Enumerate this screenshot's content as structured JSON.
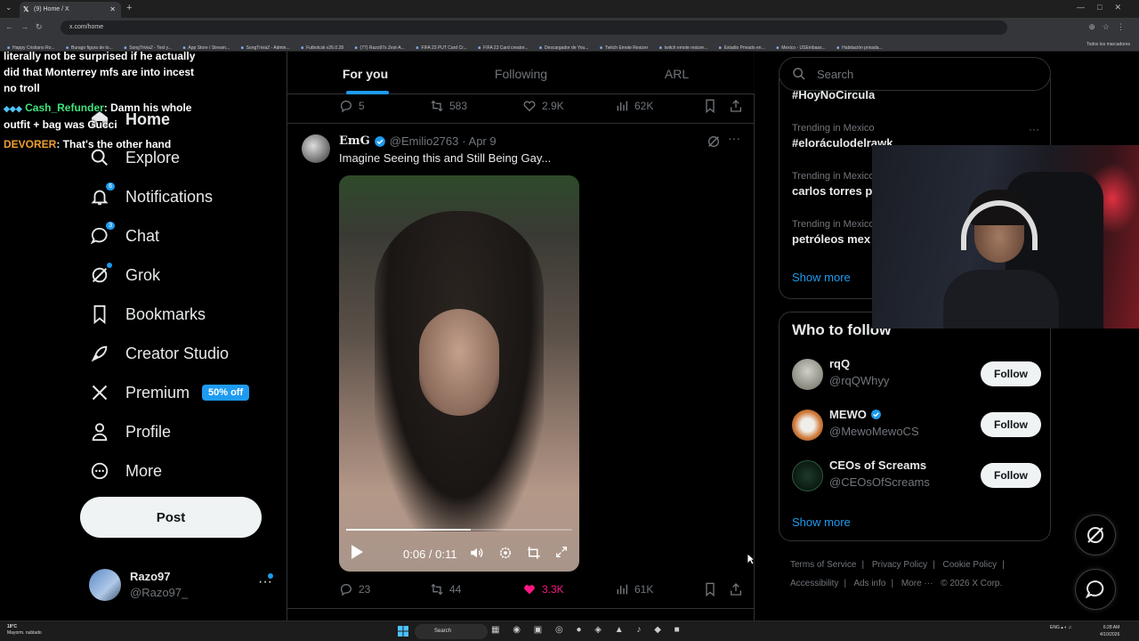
{
  "browser": {
    "tab_title": "(9) Home / X",
    "url": "x.com/home",
    "bookmarks": [
      "Happy Cristiano Ro...",
      "Burago figura de to...",
      "SongTrivia2 - Test y...",
      "App Store / Stream...",
      "SongTrivia2 - Admin...",
      "Futbolcsk v26.0.28",
      "(77) Razo97s Zest-A...",
      "FIFA 23 PUT Card Cr...",
      "FIFA 23 Card creator...",
      "Descargador de You...",
      "Twitch Emote Resizer",
      "twitch emote resizer...",
      "Estadio Privado en...",
      "Mexico - USEmbass...",
      "Habitación privada..."
    ],
    "all_bookmarks": "Todos los marcadores"
  },
  "chat": {
    "line1": "literally not be surprised if he actually did that Monterrey mfs are into incest no troll",
    "user2": "Cash_Refunder",
    "msg2": ": Damn his whole outfit + bag was Gucci",
    "user3": "DEVORER",
    "msg3": ": That's the other hand"
  },
  "nav": {
    "home": "Home",
    "explore": "Explore",
    "notifications": "Notifications",
    "notifications_badge": "6",
    "chat": "Chat",
    "chat_badge": "3",
    "grok": "Grok",
    "bookmarks": "Bookmarks",
    "creator_studio": "Creator Studio",
    "premium": "Premium",
    "premium_promo": "50% off",
    "profile": "Profile",
    "more": "More",
    "post": "Post",
    "account_name": "Razo97",
    "account_handle": "@Razo97_"
  },
  "feed": {
    "tabs": [
      "For you",
      "Following",
      "ARL"
    ],
    "prev_stats": {
      "replies": "5",
      "reposts": "583",
      "likes": "2.9K",
      "views": "62K"
    },
    "tweet": {
      "display_name": "EmG",
      "handle": "@Emilio2763",
      "date": "· Apr 9",
      "text": "Imagine Seeing this and Still Being Gay...",
      "video_time": "0:06 / 0:11",
      "video_progress": 0.55,
      "stats": {
        "replies": "23",
        "reposts": "44",
        "likes": "3.3K",
        "views": "61K"
      }
    }
  },
  "sidebar": {
    "search_placeholder": "Search",
    "trend0_name": "#HoyNoCircula",
    "trends": [
      {
        "context": "Trending in Mexico",
        "name": "#eloráculodelrawk"
      },
      {
        "context": "Trending in Mexico",
        "name": "carlos torres p"
      },
      {
        "context": "Trending in Mexico",
        "name": "petróleos mex"
      }
    ],
    "show_more": "Show more",
    "who_to_follow_title": "Who to follow",
    "follow": [
      {
        "name": "rqQ",
        "handle": "@rqQWhyy",
        "button": "Follow"
      },
      {
        "name": "MEWO",
        "handle": "@MewoMewoCS",
        "button": "Follow"
      },
      {
        "name": "CEOs of Screams",
        "handle": "@CEOsOfScreams",
        "button": "Follow"
      }
    ],
    "footer": [
      "Terms of Service",
      "Privacy Policy",
      "Cookie Policy",
      "Accessibility",
      "Ads info",
      "More ···",
      "© 2026 X Corp."
    ]
  },
  "taskbar": {
    "temp": "18°C",
    "weather": "Mayorm. nublado",
    "search": "Search",
    "lang": "ENG",
    "time": "6:28 AM",
    "date": "4/10/2026"
  },
  "colors": {
    "accent": "#1d9bf0",
    "like": "#f91880",
    "bg": "#000000"
  }
}
